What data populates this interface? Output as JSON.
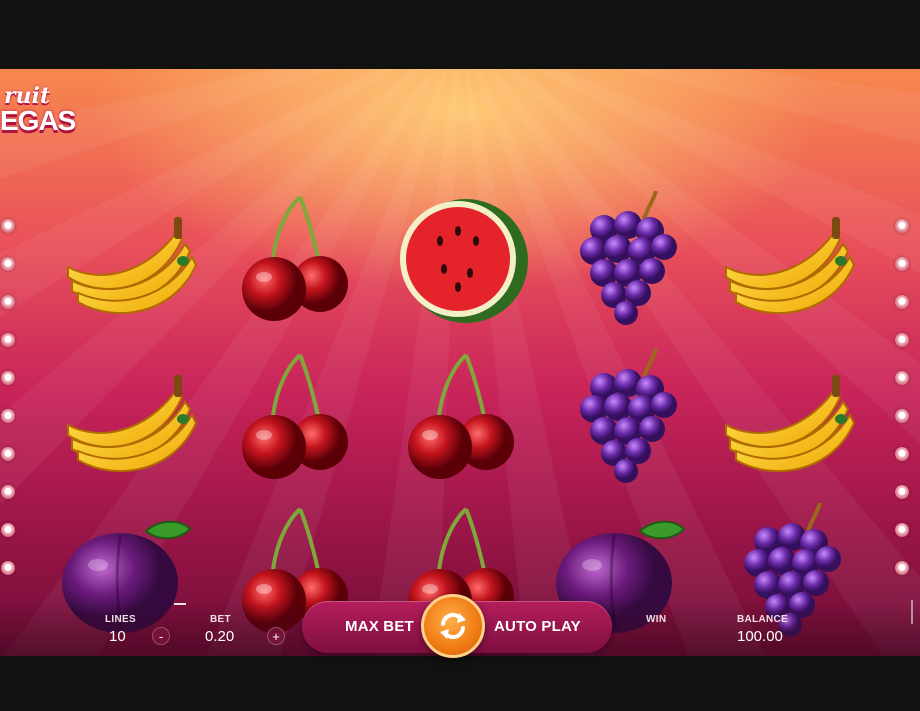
{
  "game": {
    "logo_line1": "ruit",
    "logo_line2": "EGAS"
  },
  "reels": [
    [
      "banana",
      "banana",
      "plum"
    ],
    [
      "cherry",
      "cherry",
      "cherry"
    ],
    [
      "watermelon",
      "cherry",
      "cherry"
    ],
    [
      "grapes",
      "grapes",
      "plum"
    ],
    [
      "banana",
      "banana",
      "grapes"
    ]
  ],
  "controls": {
    "lines_label": "LINES",
    "lines_value": "10",
    "decrease_label": "-",
    "bet_label": "BET",
    "bet_value": "0.20",
    "increase_label": "+",
    "max_bet_label": "MAX BET",
    "auto_play_label": "AUTO PLAY",
    "win_label": "WIN",
    "win_value": "",
    "balance_label": "BALANCE",
    "balance_value": "100.00"
  },
  "icons": {
    "spin": "spin-arrows-icon",
    "payline_marker": "payline-dot-icon"
  },
  "colors": {
    "spin_button": "#f07a12",
    "pill": "#b51e5c",
    "bg_top": "#f7884e",
    "bg_bottom": "#6e0d36"
  }
}
